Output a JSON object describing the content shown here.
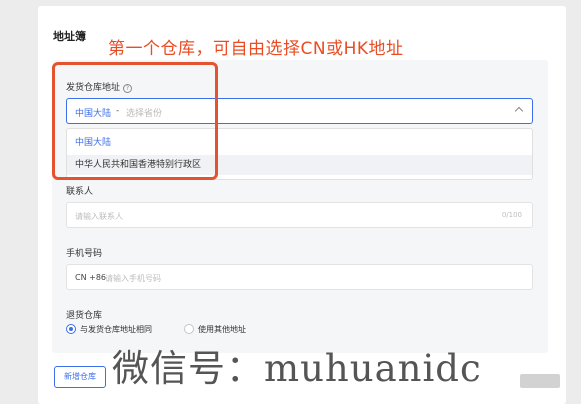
{
  "card": {
    "title": "地址簿",
    "annotation": "第一个仓库，可自由选择CN或HK地址"
  },
  "warehouse": {
    "label": "发货仓库地址",
    "help_icon": "?",
    "selected_value": "中国大陆",
    "separator": "-",
    "placeholder": "选择省份",
    "options": [
      {
        "label": "中国大陆"
      },
      {
        "label": "中华人民共和国香港特别行政区"
      }
    ]
  },
  "contact": {
    "label": "联系人",
    "placeholder": "请输入联系人",
    "counter": "0/100"
  },
  "phone": {
    "label": "手机号码",
    "prefix": "CN +86",
    "placeholder": "请输入手机号码"
  },
  "return_warehouse": {
    "label": "退货仓库",
    "options": [
      {
        "label": "与发货仓库地址相同",
        "checked": true
      },
      {
        "label": "使用其他地址",
        "checked": false
      }
    ]
  },
  "actions": {
    "add_warehouse": "新增仓库"
  },
  "watermark": "微信号：muhuanidc",
  "colors": {
    "accent": "#3d6eec",
    "annotation": "#ea4c23",
    "highlight_border": "#e4532f"
  }
}
